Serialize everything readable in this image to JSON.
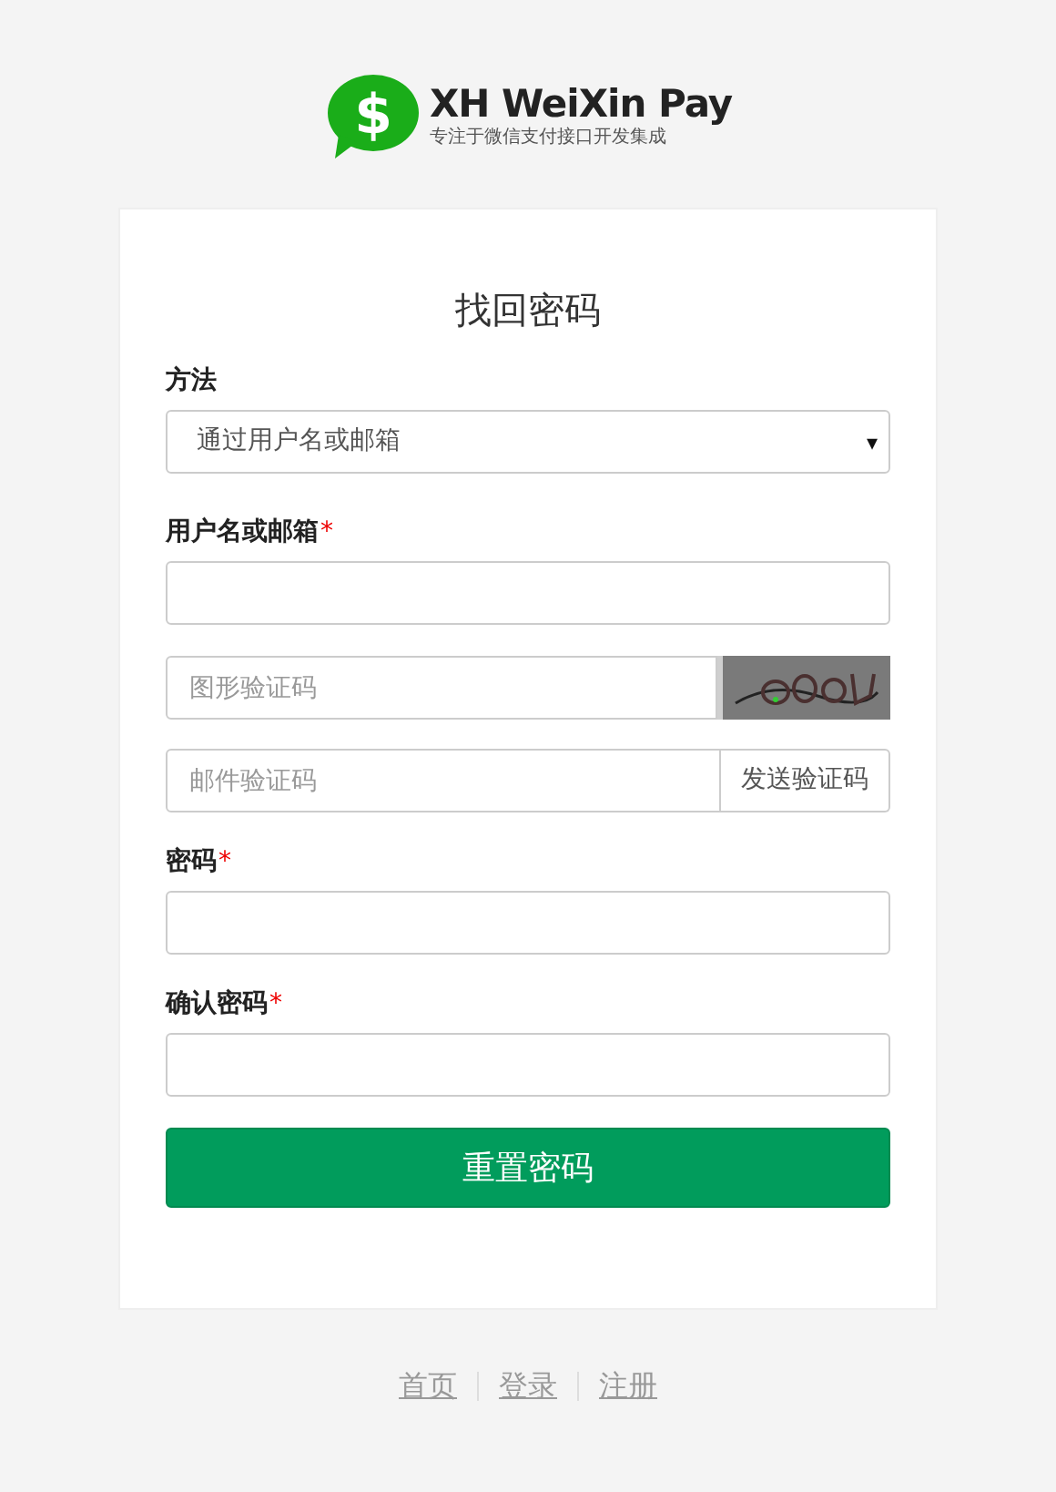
{
  "logo": {
    "symbol": "$",
    "title": "XH WeiXin Pay",
    "subtitle": "专注于微信支付接口开发集成"
  },
  "form": {
    "title": "找回密码",
    "fields": [
      {
        "kind": "select",
        "label": "方法",
        "required": false,
        "value": "通过用户名或邮箱",
        "caret": "▾"
      },
      {
        "kind": "input",
        "label": "用户名或邮箱",
        "required": true
      },
      {
        "kind": "captcha",
        "placeholder": "图形验证码"
      },
      {
        "kind": "code",
        "placeholder": "邮件验证码",
        "button": "发送验证码"
      },
      {
        "kind": "input",
        "label": "密码",
        "required": true
      },
      {
        "kind": "input",
        "label": "确认密码",
        "required": true
      }
    ],
    "required_mark": "*",
    "submit": "重置密码"
  },
  "footer_links": [
    "首页",
    "登录",
    "注册"
  ]
}
